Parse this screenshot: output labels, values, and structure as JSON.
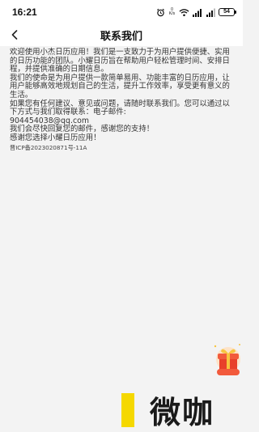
{
  "status_bar": {
    "time": "16:21",
    "net_speed_value": "0",
    "net_speed_unit": "K/s",
    "battery": "54"
  },
  "nav": {
    "title": "联系我们"
  },
  "content": {
    "paragraphs": [
      "欢迎使用小杰日历应用！我们是一支致力于为用户提供便捷、实用的日历功能的团队。小耀日历旨在帮助用户轻松管理时间、安排日程，并提供准确的日期信息。",
      "我们的使命是为用户提供一款简单易用、功能丰富的日历应用，让用户能够高效地规划自己的生活，提升工作效率，享受更有意义的生活。",
      "如果您有任何建议、意见或问题，请随时联系我们。您可以通过以下方式与我们取得联系：电子邮件:",
      "904454038@qq.com",
      "我们会尽快回复您的邮件，感谢您的支持！",
      "感谢您选择小耀日历应用！"
    ],
    "icp": "晋ICP备2023020871号-11A"
  },
  "watermark": {
    "text": "微咖"
  },
  "colors": {
    "background": "#f3f3f3",
    "bar_background": "#ffffff",
    "watermark_accent": "#f5d800",
    "promo_red": "#e8402a"
  }
}
